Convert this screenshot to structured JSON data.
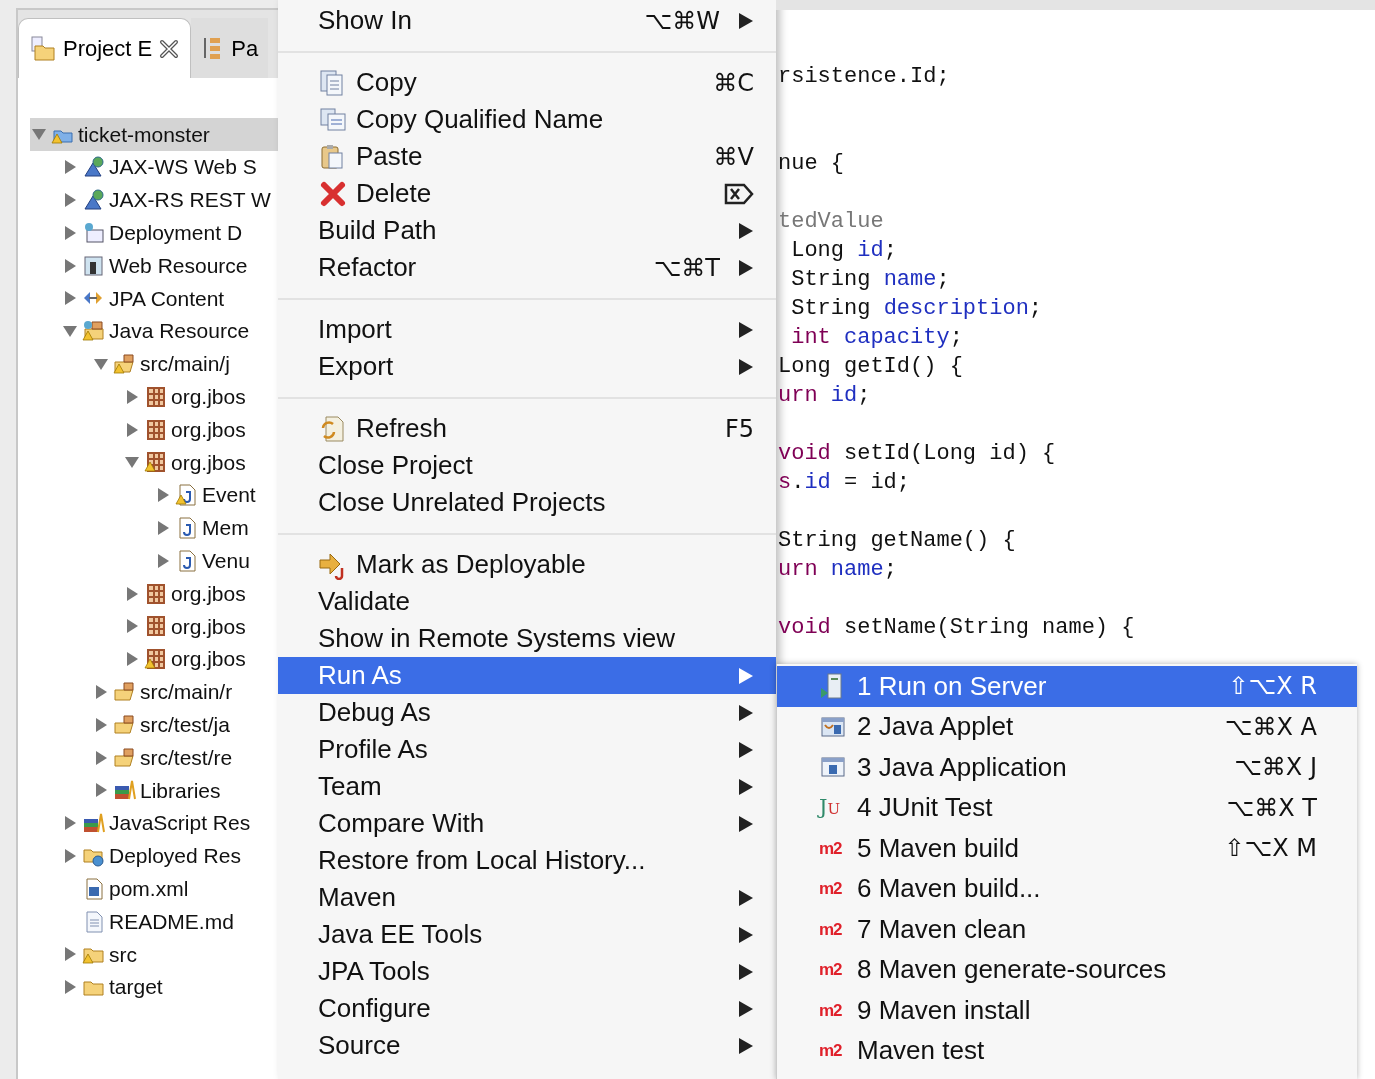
{
  "explorer": {
    "tabs": [
      {
        "label": "Project E",
        "kind": "project",
        "selected": true,
        "closable": true
      },
      {
        "label": "Pa",
        "kind": "package",
        "selected": false,
        "closable": false
      }
    ],
    "tree": [
      {
        "label": "ticket-monster",
        "kind": "project",
        "warning": true,
        "selected": true,
        "expanded": true,
        "children": [
          {
            "label": "JAX-WS Web S",
            "kind": "webservice",
            "warning": false,
            "selected": false,
            "expanded": false
          },
          {
            "label": "JAX-RS REST W",
            "kind": "webservice",
            "warning": false,
            "selected": false,
            "expanded": false
          },
          {
            "label": "Deployment D",
            "kind": "deployment",
            "warning": false,
            "selected": false,
            "expanded": false
          },
          {
            "label": "Web Resource",
            "kind": "webresources",
            "warning": false,
            "selected": false,
            "expanded": false
          },
          {
            "label": "JPA Content",
            "kind": "jpa",
            "warning": false,
            "selected": false,
            "expanded": false
          },
          {
            "label": "Java Resource",
            "kind": "javaresources",
            "warning": true,
            "selected": false,
            "expanded": true,
            "children": [
              {
                "label": "src/main/j",
                "kind": "sourcefolder",
                "warning": true,
                "selected": false,
                "expanded": true,
                "children": [
                  {
                    "label": "org.jbos",
                    "kind": "package",
                    "warning": false,
                    "selected": false,
                    "expanded": false
                  },
                  {
                    "label": "org.jbos",
                    "kind": "package",
                    "warning": false,
                    "selected": false,
                    "expanded": false
                  },
                  {
                    "label": "org.jbos",
                    "kind": "package",
                    "warning": true,
                    "selected": false,
                    "expanded": true,
                    "children": [
                      {
                        "label": "Event",
                        "kind": "javafile",
                        "warning": true,
                        "selected": false,
                        "expanded": false
                      },
                      {
                        "label": "Mem",
                        "kind": "javafile",
                        "warning": false,
                        "selected": false,
                        "expanded": false
                      },
                      {
                        "label": "Venu",
                        "kind": "javafile",
                        "warning": false,
                        "selected": false,
                        "expanded": false
                      }
                    ]
                  },
                  {
                    "label": "org.jbos",
                    "kind": "package",
                    "warning": false,
                    "selected": false,
                    "expanded": false
                  },
                  {
                    "label": "org.jbos",
                    "kind": "package",
                    "warning": false,
                    "selected": false,
                    "expanded": false
                  },
                  {
                    "label": "org.jbos",
                    "kind": "package",
                    "warning": true,
                    "selected": false,
                    "expanded": false
                  }
                ]
              },
              {
                "label": "src/main/r",
                "kind": "sourcefolder",
                "warning": false,
                "selected": false,
                "expanded": false
              },
              {
                "label": "src/test/ja",
                "kind": "sourcefolder",
                "warning": false,
                "selected": false,
                "expanded": false
              },
              {
                "label": "src/test/re",
                "kind": "sourcefolder",
                "warning": false,
                "selected": false,
                "expanded": false
              },
              {
                "label": "Libraries",
                "kind": "library",
                "warning": false,
                "selected": false,
                "expanded": false
              }
            ]
          },
          {
            "label": "JavaScript Res",
            "kind": "library",
            "warning": false,
            "selected": false,
            "expanded": false
          },
          {
            "label": "Deployed Res",
            "kind": "deployed",
            "warning": false,
            "selected": false,
            "expanded": false
          },
          {
            "label": "pom.xml",
            "kind": "pom",
            "warning": false,
            "selected": false,
            "leaf": true
          },
          {
            "label": "README.md",
            "kind": "textfile",
            "warning": false,
            "selected": false,
            "leaf": true
          },
          {
            "label": "src",
            "kind": "folder",
            "warning": true,
            "selected": false,
            "expanded": false
          },
          {
            "label": "target",
            "kind": "folder",
            "warning": false,
            "selected": false,
            "expanded": false
          }
        ]
      }
    ]
  },
  "context_menu": {
    "items": [
      {
        "kind": "plain",
        "label": "Show In",
        "shortcut": "⌥⌘W",
        "submenu": true,
        "selected": false
      },
      {
        "kind": "separator"
      },
      {
        "kind": "copy",
        "label": "Copy",
        "shortcut": "⌘C",
        "submenu": false,
        "selected": false
      },
      {
        "kind": "copyqualified",
        "label": "Copy Qualified Name",
        "submenu": false,
        "selected": false
      },
      {
        "kind": "paste",
        "label": "Paste",
        "shortcut": "⌘V",
        "submenu": false,
        "selected": false
      },
      {
        "kind": "delete",
        "label": "Delete",
        "delete_key": true,
        "submenu": false,
        "selected": false
      },
      {
        "kind": "plain",
        "label": "Build Path",
        "submenu": true,
        "selected": false
      },
      {
        "kind": "plain",
        "label": "Refactor",
        "shortcut": "⌥⌘T",
        "submenu": true,
        "selected": false
      },
      {
        "kind": "separator"
      },
      {
        "kind": "plain",
        "label": "Import",
        "submenu": true,
        "selected": false
      },
      {
        "kind": "plain",
        "label": "Export",
        "submenu": true,
        "selected": false
      },
      {
        "kind": "separator"
      },
      {
        "kind": "refresh",
        "label": "Refresh",
        "shortcut": "F5",
        "submenu": false,
        "selected": false
      },
      {
        "kind": "plain",
        "label": "Close Project",
        "submenu": false,
        "selected": false
      },
      {
        "kind": "plain",
        "label": "Close Unrelated Projects",
        "submenu": false,
        "selected": false
      },
      {
        "kind": "separator"
      },
      {
        "kind": "deployable",
        "label": "Mark as Deployable",
        "submenu": false,
        "selected": false
      },
      {
        "kind": "plain",
        "label": "Validate",
        "submenu": false,
        "selected": false
      },
      {
        "kind": "plain",
        "label": "Show in Remote Systems view",
        "submenu": false,
        "selected": false
      },
      {
        "kind": "plain",
        "label": "Run As",
        "submenu": true,
        "selected": true
      },
      {
        "kind": "plain",
        "label": "Debug As",
        "submenu": true,
        "selected": false
      },
      {
        "kind": "plain",
        "label": "Profile As",
        "submenu": true,
        "selected": false
      },
      {
        "kind": "plain",
        "label": "Team",
        "submenu": true,
        "selected": false
      },
      {
        "kind": "plain",
        "label": "Compare With",
        "submenu": true,
        "selected": false
      },
      {
        "kind": "plain",
        "label": "Restore from Local History...",
        "submenu": false,
        "selected": false
      },
      {
        "kind": "plain",
        "label": "Maven",
        "submenu": true,
        "selected": false
      },
      {
        "kind": "plain",
        "label": "Java EE Tools",
        "submenu": true,
        "selected": false
      },
      {
        "kind": "plain",
        "label": "JPA Tools",
        "submenu": true,
        "selected": false
      },
      {
        "kind": "plain",
        "label": "Configure",
        "submenu": true,
        "selected": false
      },
      {
        "kind": "plain",
        "label": "Source",
        "submenu": true,
        "selected": false
      }
    ]
  },
  "editor": {
    "lines": [
      {
        "kind": "code",
        "segments": [
          {
            "kind": "plain",
            "text": "rsistence.Id;"
          }
        ]
      },
      {
        "kind": "blank"
      },
      {
        "kind": "blank"
      },
      {
        "kind": "code",
        "segments": [
          {
            "kind": "plain",
            "text": "nue {"
          }
        ]
      },
      {
        "kind": "blank"
      },
      {
        "kind": "code",
        "segments": [
          {
            "kind": "annotation",
            "text": "tedValue"
          }
        ]
      },
      {
        "kind": "code",
        "segments": [
          {
            "kind": "plain",
            "text": " Long "
          },
          {
            "kind": "field",
            "text": "id"
          },
          {
            "kind": "plain",
            "text": ";"
          }
        ]
      },
      {
        "kind": "code",
        "segments": [
          {
            "kind": "plain",
            "text": " String "
          },
          {
            "kind": "field",
            "text": "name"
          },
          {
            "kind": "plain",
            "text": ";"
          }
        ]
      },
      {
        "kind": "code",
        "segments": [
          {
            "kind": "plain",
            "text": " String "
          },
          {
            "kind": "field",
            "text": "description"
          },
          {
            "kind": "plain",
            "text": ";"
          }
        ]
      },
      {
        "kind": "code",
        "segments": [
          {
            "kind": "keyword",
            "text": " int"
          },
          {
            "kind": "field",
            "text": " capacity"
          },
          {
            "kind": "plain",
            "text": ";"
          }
        ]
      },
      {
        "kind": "code",
        "segments": [
          {
            "kind": "plain",
            "text": "Long getId() {"
          }
        ]
      },
      {
        "kind": "code",
        "segments": [
          {
            "kind": "keyword",
            "text": "urn"
          },
          {
            "kind": "field",
            "text": " id"
          },
          {
            "kind": "plain",
            "text": ";"
          }
        ]
      },
      {
        "kind": "blank"
      },
      {
        "kind": "code",
        "segments": [
          {
            "kind": "keyword",
            "text": "void"
          },
          {
            "kind": "plain",
            "text": " setId(Long id) {"
          }
        ]
      },
      {
        "kind": "code",
        "segments": [
          {
            "kind": "keyword",
            "text": "s"
          },
          {
            "kind": "plain",
            "text": "."
          },
          {
            "kind": "field",
            "text": "id"
          },
          {
            "kind": "plain",
            "text": " = id;"
          }
        ]
      },
      {
        "kind": "blank"
      },
      {
        "kind": "code",
        "segments": [
          {
            "kind": "plain",
            "text": "String getName() {"
          }
        ]
      },
      {
        "kind": "code",
        "segments": [
          {
            "kind": "keyword",
            "text": "urn"
          },
          {
            "kind": "field",
            "text": " name"
          },
          {
            "kind": "plain",
            "text": ";"
          }
        ]
      },
      {
        "kind": "blank"
      },
      {
        "kind": "code",
        "segments": [
          {
            "kind": "keyword",
            "text": "void"
          },
          {
            "kind": "plain",
            "text": " setName(String name) {"
          }
        ]
      }
    ]
  },
  "run_as_menu": {
    "items": [
      {
        "kind": "server",
        "label": "1 Run on Server",
        "shortcut": "⇧⌥X R",
        "selected": true
      },
      {
        "kind": "applet",
        "label": "2 Java Applet",
        "shortcut": "⌥⌘X A",
        "selected": false
      },
      {
        "kind": "application",
        "label": "3 Java Application",
        "shortcut": "⌥⌘X J",
        "selected": false
      },
      {
        "kind": "junit",
        "badge": "JU",
        "label": "4 JUnit Test",
        "shortcut": "⌥⌘X T",
        "selected": false
      },
      {
        "kind": "maven",
        "badge": "m2",
        "label": "5 Maven build",
        "shortcut": "⇧⌥X M",
        "selected": false
      },
      {
        "kind": "maven",
        "badge": "m2",
        "label": "6 Maven build...",
        "selected": false
      },
      {
        "kind": "maven",
        "badge": "m2",
        "label": "7 Maven clean",
        "selected": false
      },
      {
        "kind": "maven",
        "badge": "m2",
        "label": "8 Maven generate-sources",
        "selected": false
      },
      {
        "kind": "maven",
        "badge": "m2",
        "label": "9 Maven install",
        "selected": false
      },
      {
        "kind": "maven",
        "badge": "m2",
        "label": "Maven test",
        "selected": false
      }
    ]
  }
}
